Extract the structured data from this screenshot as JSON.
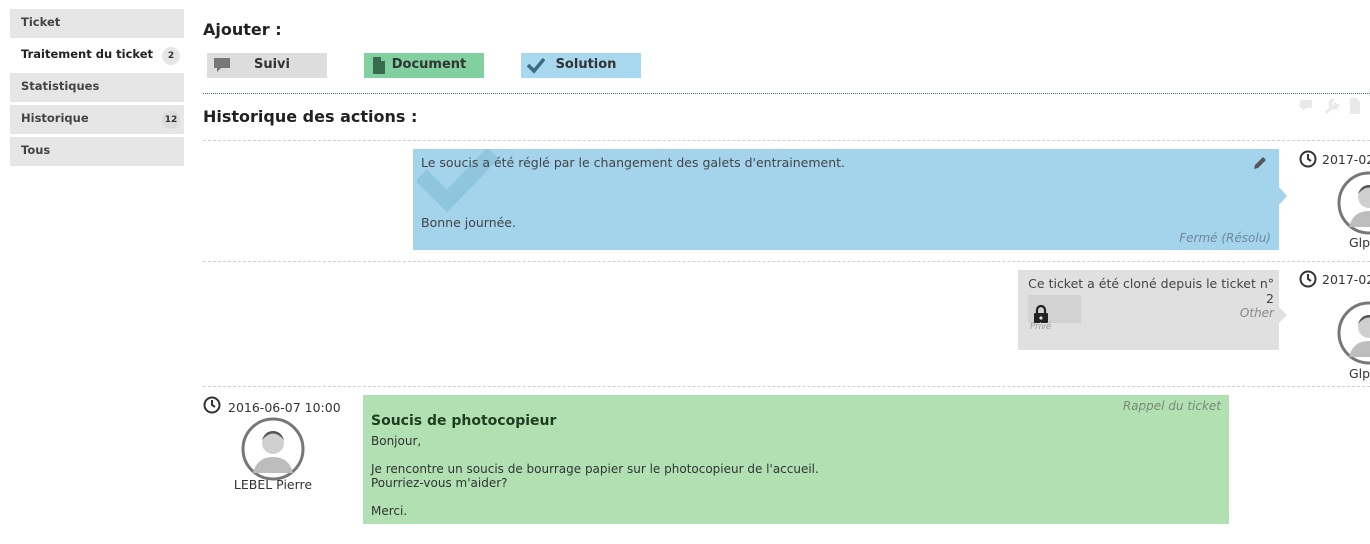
{
  "sidebar": {
    "tabs": [
      {
        "label": "Ticket",
        "badge": ""
      },
      {
        "label": "Traitement du ticket",
        "badge": "2"
      },
      {
        "label": "Statistiques",
        "badge": ""
      },
      {
        "label": "Historique",
        "badge": "12"
      },
      {
        "label": "Tous",
        "badge": ""
      }
    ]
  },
  "add": {
    "title": "Ajouter :",
    "buttons": [
      {
        "label": "Suivi",
        "icon": "speech-bubble-icon"
      },
      {
        "label": "Document",
        "icon": "document-icon"
      },
      {
        "label": "Solution",
        "icon": "checkmark-icon"
      }
    ]
  },
  "history": {
    "title": "Historique des actions :",
    "items": [
      {
        "type": "solution",
        "date": "2017-02",
        "user": "Glp",
        "text_line1": "Le soucis a été réglé par le changement des galets d'entrainement.",
        "text_line2": "Bonne journée.",
        "status": "Fermé (Résolu)"
      },
      {
        "type": "log",
        "date": "2017-02",
        "user": "Glp",
        "text": "Ce ticket a été cloné depuis le ticket n° 2",
        "category": "Other",
        "private_label": "Privé"
      },
      {
        "type": "followup",
        "date": "2016-06-07 10:00",
        "user": "LEBEL Pierre",
        "label": "Rappel du ticket",
        "subject": "Soucis de photocopieur",
        "lines": [
          "Bonjour,",
          "Je rencontre un soucis de bourrage papier sur le photocopieur de l'accueil.",
          "Pourriez-vous m'aider?",
          "Merci."
        ]
      }
    ]
  },
  "colors": {
    "solution": "#a3d4ec",
    "log": "#e0e0e0",
    "followup": "#b1e0b3",
    "document_button": "#80d0a0",
    "solution_button": "#a8d8ee",
    "suivi_button": "#dddddd"
  }
}
